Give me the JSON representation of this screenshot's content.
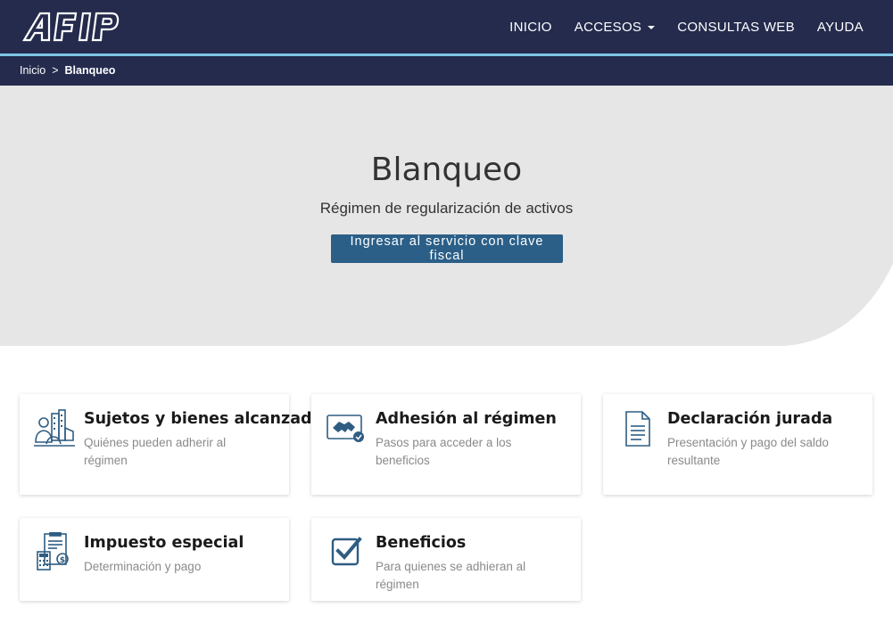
{
  "header": {
    "nav": [
      {
        "label": "INICIO"
      },
      {
        "label": "ACCESOS"
      },
      {
        "label": "CONSULTAS WEB"
      },
      {
        "label": "AYUDA"
      }
    ]
  },
  "breadcrumb": {
    "home": "Inicio",
    "separator": ">",
    "current": "Blanqueo"
  },
  "hero": {
    "title": "Blanqueo",
    "subtitle": "Régimen de regularización de activos",
    "button_label": "Ingresar al servicio con clave fiscal"
  },
  "cards": [
    {
      "title": "Sujetos y bienes alcanzados",
      "desc": "Quiénes pueden adherir al régimen",
      "icon": "people-buildings-icon"
    },
    {
      "title": "Adhesión al régimen",
      "desc": "Pasos para acceder a los beneficios",
      "icon": "handshake-icon"
    },
    {
      "title": "Declaración jurada",
      "desc": "Presentación y pago del saldo resultante",
      "icon": "document-icon"
    },
    {
      "title": "Impuesto especial",
      "desc": "Determinación y pago",
      "icon": "calculator-document-icon"
    },
    {
      "title": "Beneficios",
      "desc": "Para quienes se adhieran al régimen",
      "icon": "checkbox-icon"
    }
  ],
  "colors": {
    "header_bg": "#242b4d",
    "header_line": "#7fc6e6",
    "hero_bg": "#e6e6e6",
    "button_bg": "#2b5f88",
    "icon_blue": "#2f5d82"
  }
}
